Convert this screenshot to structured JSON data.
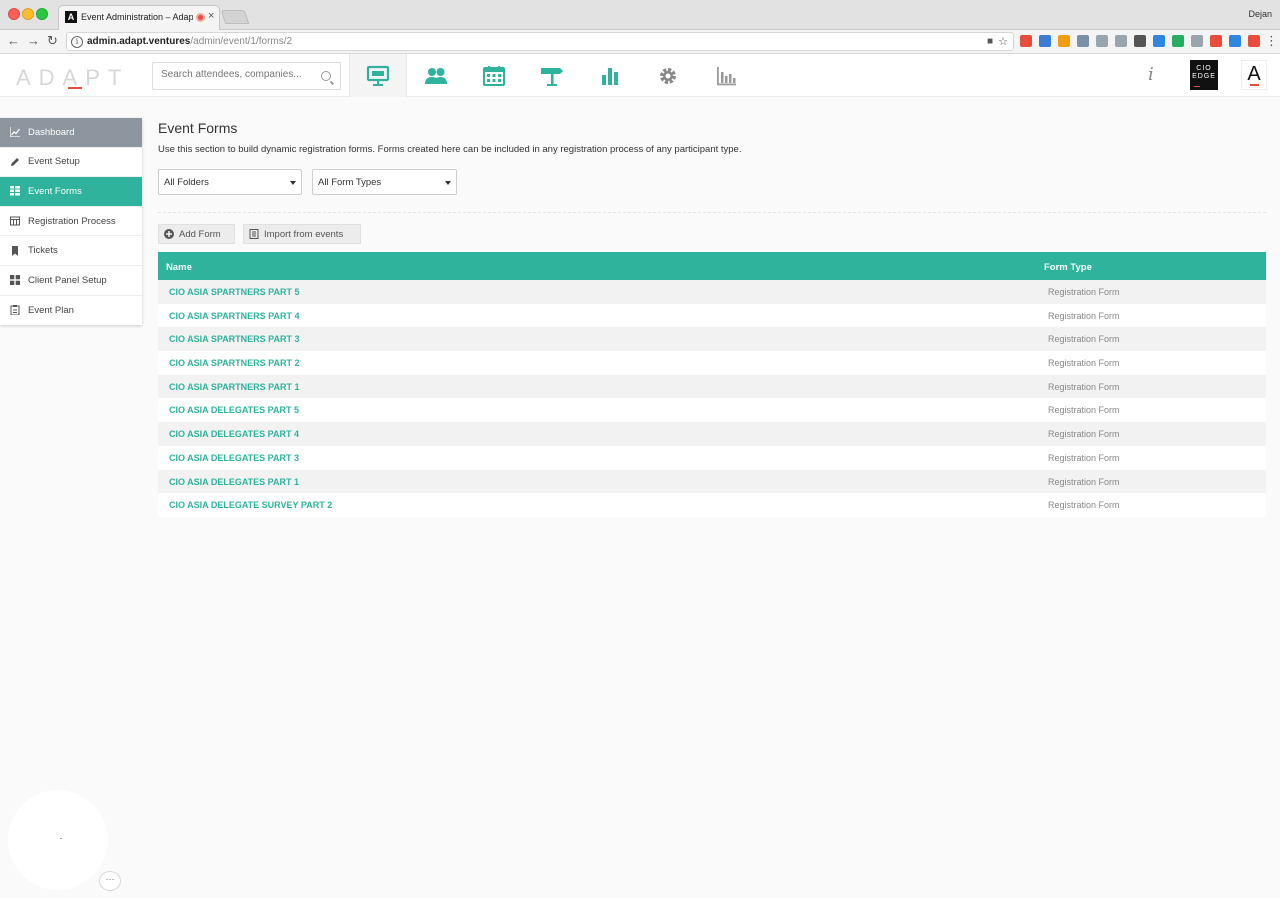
{
  "browser": {
    "tab_title": "Event Administration – Adapt",
    "tab_close": "×",
    "profile_name": "Dejan",
    "url_host": "admin.adapt.ventures",
    "url_path": "/admin/event/1/forms/2",
    "extension_colors": [
      "#e74c3c",
      "#3a7bd5",
      "#f39c12",
      "#7b8fa6",
      "#9aa4ad",
      "#9aa4ad",
      "#555555",
      "#2e86de",
      "#27ae60",
      "#9aa4ad",
      "#e74c3c",
      "#2e86de",
      "#e74c3c"
    ]
  },
  "app_header": {
    "logo_text": "ADAPT",
    "search_placeholder": "Search attendees, companies...",
    "nav_icons": [
      "presentation-icon",
      "people-icon",
      "calendar-icon",
      "signpost-icon",
      "bar-chart-icon",
      "gear-icon",
      "analytics-icon"
    ],
    "info_label": "i",
    "cio_logo_lines": [
      "CIO",
      "EDGE"
    ],
    "a_logo_text": "A",
    "accent_color": "#2fb39d",
    "logo_accent_color": "#e74c3c"
  },
  "sidebar": {
    "items": [
      {
        "label": "Dashboard",
        "icon": "line-chart-icon",
        "state": "header"
      },
      {
        "label": "Event Setup",
        "icon": "pencil-icon",
        "state": "normal"
      },
      {
        "label": "Event Forms",
        "icon": "grid-icon",
        "state": "active"
      },
      {
        "label": "Registration Process",
        "icon": "table-icon",
        "state": "normal"
      },
      {
        "label": "Tickets",
        "icon": "bookmark-icon",
        "state": "normal"
      },
      {
        "label": "Client Panel Setup",
        "icon": "squares-icon",
        "state": "normal"
      },
      {
        "label": "Event Plan",
        "icon": "clipboard-icon",
        "state": "normal"
      }
    ]
  },
  "main": {
    "title": "Event Forms",
    "description": "Use this section to build dynamic registration forms. Forms created here can be included in any registration process of any participant type.",
    "folder_select": "All Folders",
    "type_select": "All Form Types",
    "add_form_label": "Add Form",
    "import_label": "Import from events",
    "table": {
      "columns": [
        "Name",
        "Form Type"
      ],
      "rows": [
        {
          "name": "CIO ASIA SPARTNERS PART 5",
          "type": "Registration Form"
        },
        {
          "name": "CIO ASIA SPARTNERS PART 4",
          "type": "Registration Form"
        },
        {
          "name": "CIO ASIA SPARTNERS PART 3",
          "type": "Registration Form"
        },
        {
          "name": "CIO ASIA SPARTNERS PART 2",
          "type": "Registration Form"
        },
        {
          "name": "CIO ASIA SPARTNERS PART 1",
          "type": "Registration Form"
        },
        {
          "name": "CIO ASIA DELEGATES PART 5",
          "type": "Registration Form"
        },
        {
          "name": "CIO ASIA DELEGATES PART 4",
          "type": "Registration Form"
        },
        {
          "name": "CIO ASIA DELEGATES PART 3",
          "type": "Registration Form"
        },
        {
          "name": "CIO ASIA DELEGATES PART 1",
          "type": "Registration Form"
        },
        {
          "name": "CIO ASIA DELEGATE SURVEY PART 2",
          "type": "Registration Form"
        }
      ]
    }
  },
  "chat": {
    "more_label": "···"
  }
}
